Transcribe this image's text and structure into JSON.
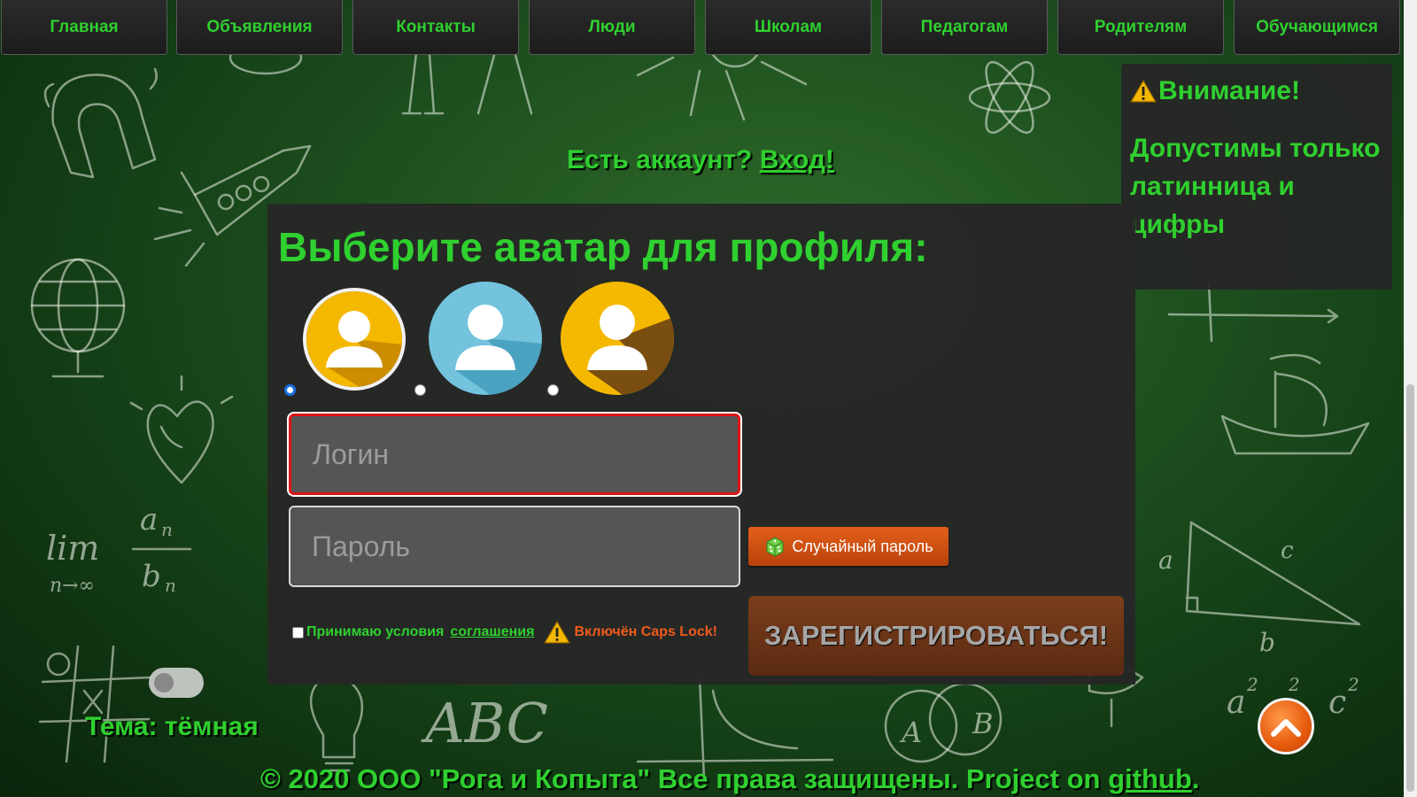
{
  "nav": {
    "items": [
      "Главная",
      "Объявления",
      "Контакты",
      "Люди",
      "Школам",
      "Педагогам",
      "Родителям",
      "Обучающимся"
    ]
  },
  "warning": {
    "title": "Внимание!",
    "text": "Допустимы только латинница и цифры"
  },
  "account": {
    "prompt": "Есть аккаунт?",
    "link": "Вход!"
  },
  "form": {
    "title": "Выберите аватар для профиля:",
    "avatars": [
      "avatar-yellow",
      "avatar-blue",
      "avatar-gold"
    ],
    "selected_avatar_index": 0,
    "login_placeholder": "Логин",
    "password_placeholder": "Пароль",
    "random_password_label": "Случайный пароль",
    "terms_label": "Принимаю условия",
    "terms_link": "соглашения",
    "caps_lock_warning": "Включён Caps Lock!",
    "register_label": "ЗАРЕГИСТРИРОВАТЬСЯ!"
  },
  "theme": {
    "label": "Тема: тёмная"
  },
  "footer": {
    "text": "© 2020 ООО \"Рога и Копыта\" Все права защищены. Project on ",
    "link": "github",
    "end": "."
  },
  "colors": {
    "accent_green": "#2fd02f",
    "orange": "#e35f1a",
    "error_red": "#e01515"
  }
}
